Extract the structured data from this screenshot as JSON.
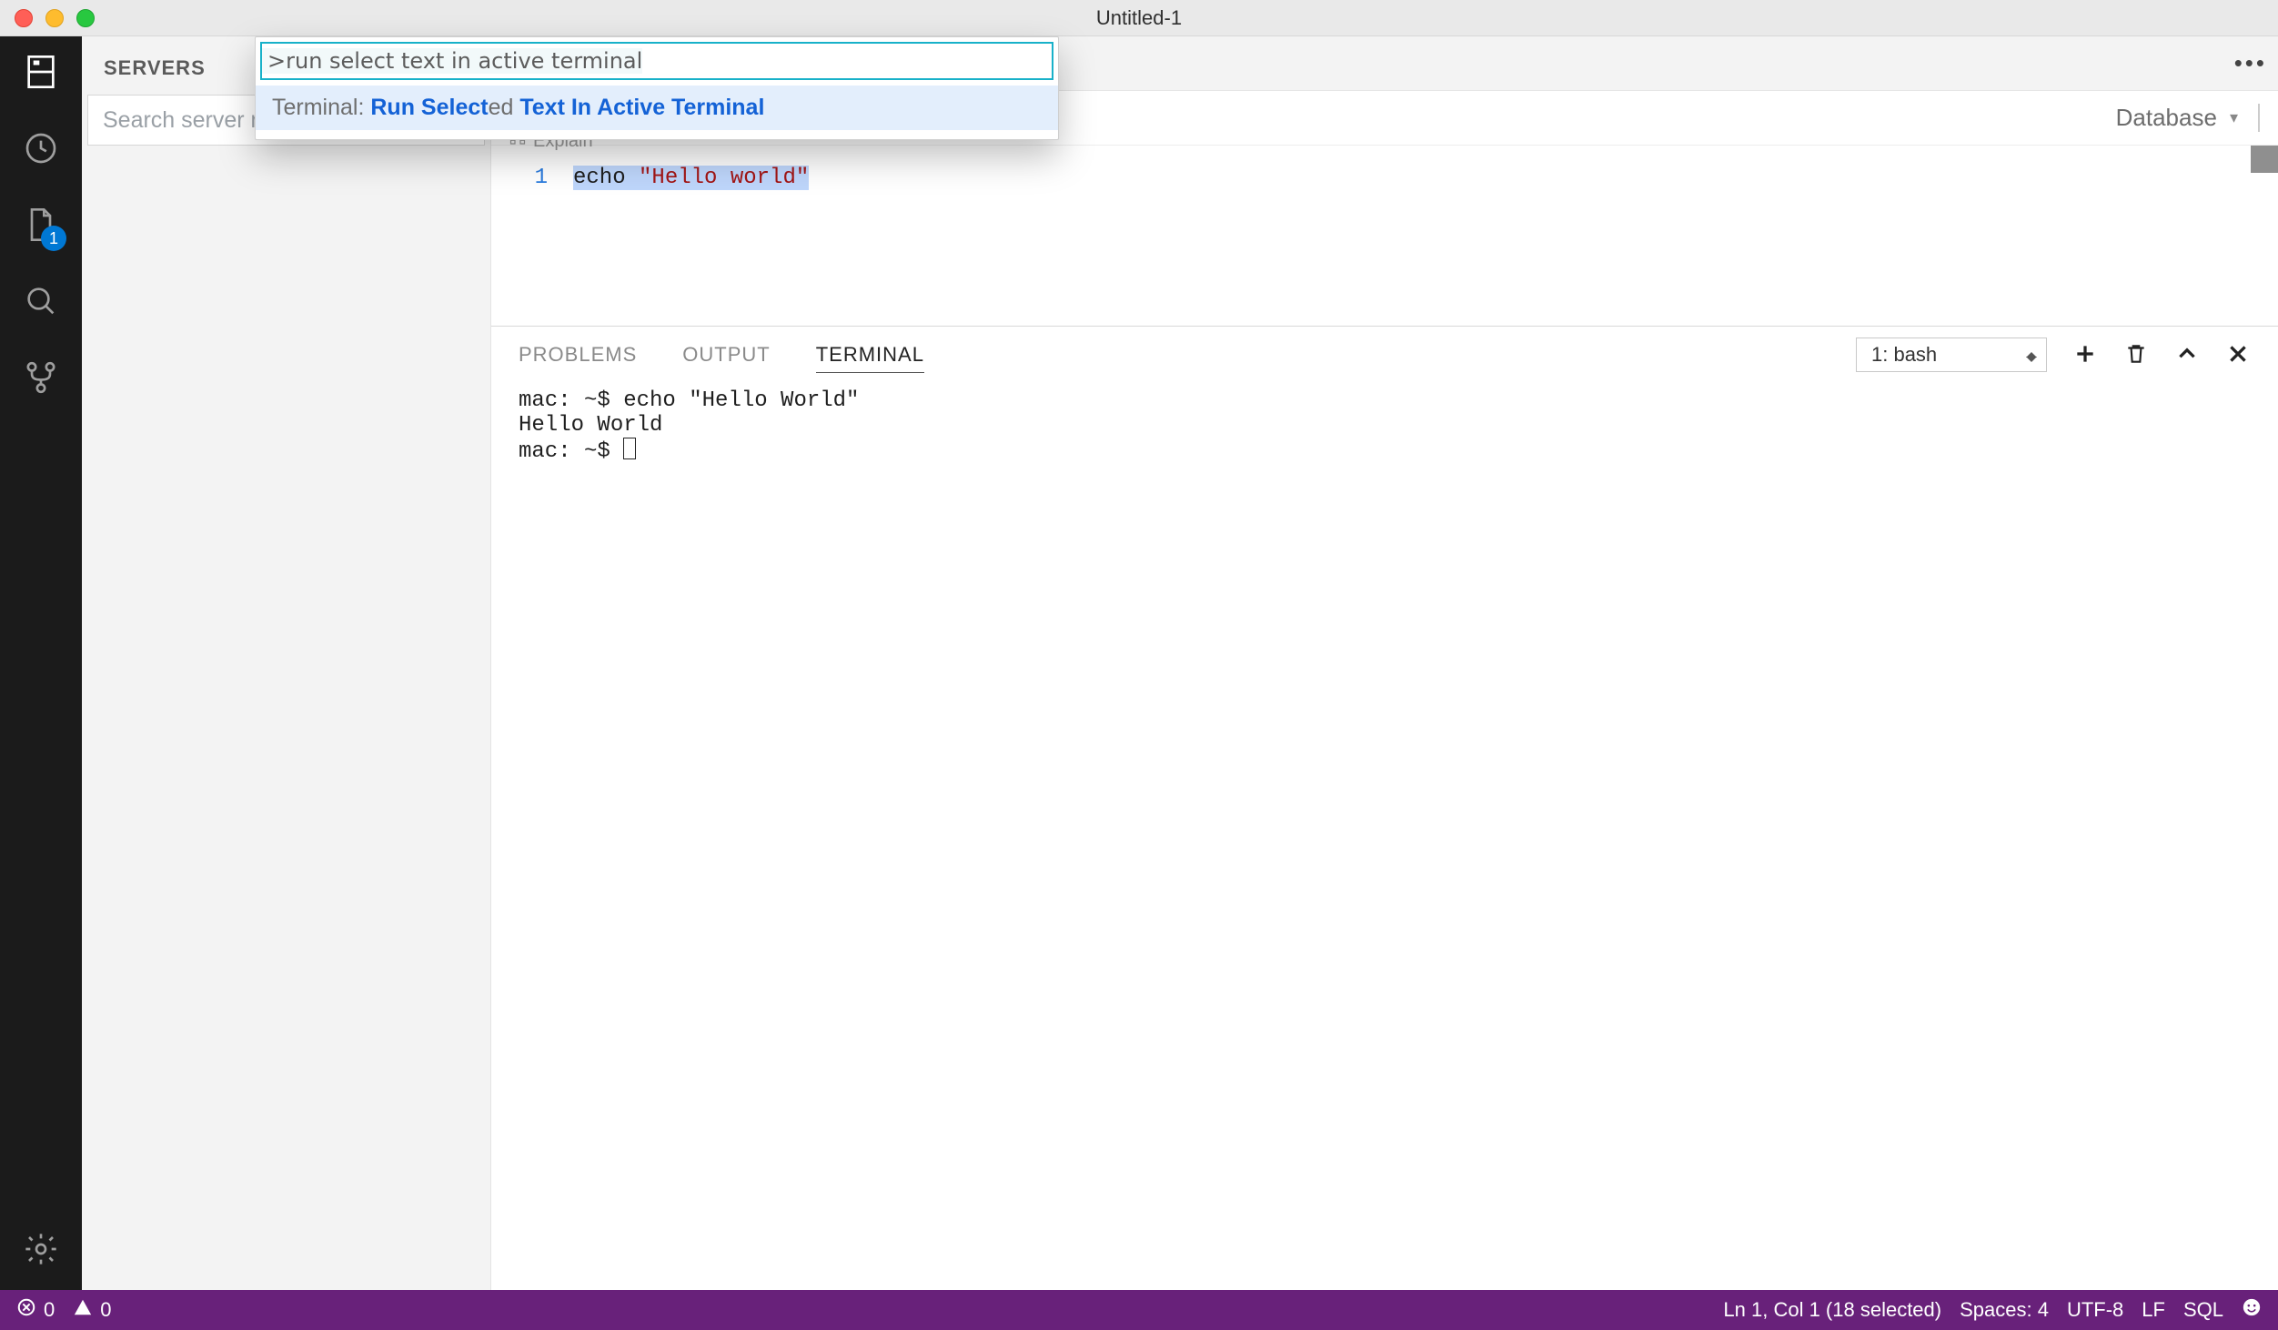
{
  "window": {
    "title": "Untitled-1"
  },
  "activity": {
    "file_badge": "1"
  },
  "sidebar": {
    "title": "SERVERS",
    "search_placeholder": "Search server name"
  },
  "breadcrumb": {
    "leaf": "Explain"
  },
  "db_picker": {
    "label": "Database"
  },
  "tab_actions": {
    "ellipsis": "•••"
  },
  "editor": {
    "line_number": "1",
    "code_plain": "echo ",
    "code_string": "\"Hello world\""
  },
  "panel": {
    "tabs": {
      "problems": "PROBLEMS",
      "output": "OUTPUT",
      "terminal": "TERMINAL"
    },
    "terminal_select": "1: bash",
    "terminal_content": "mac: ~$ echo \"Hello World\"\nHello World\nmac: ~$ "
  },
  "palette": {
    "query": ">run select text in active terminal",
    "result": {
      "prefix": "Terminal: ",
      "hl1": "Run Select",
      "mid": "ed ",
      "hl2": "Text In Active Terminal"
    }
  },
  "status": {
    "errors": "0",
    "warnings": "0",
    "selection": "Ln 1, Col 1 (18 selected)",
    "indent": "Spaces: 4",
    "encoding": "UTF-8",
    "eol": "LF",
    "language": "SQL"
  }
}
